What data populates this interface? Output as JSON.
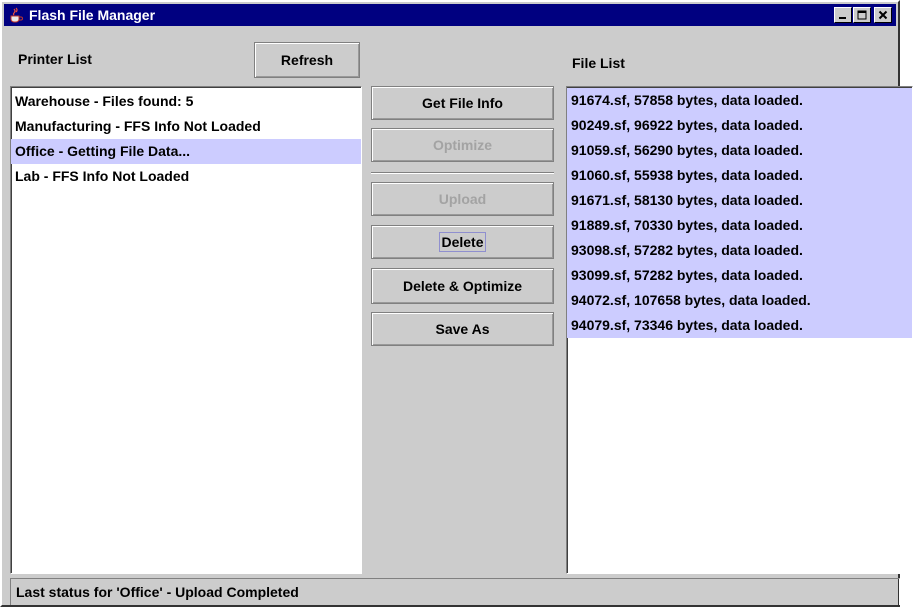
{
  "window": {
    "title": "Flash File Manager",
    "icon": "java-cup-icon",
    "controls": [
      "minimize-icon",
      "maximize-icon",
      "close-icon"
    ]
  },
  "printers": {
    "label": "Printer List",
    "refresh_label": "Refresh",
    "items": [
      {
        "text": "Warehouse - Files found: 5",
        "selected": false
      },
      {
        "text": "Manufacturing - FFS Info Not Loaded",
        "selected": false
      },
      {
        "text": "Office - Getting File Data...",
        "selected": true
      },
      {
        "text": "Lab - FFS Info Not Loaded",
        "selected": false
      }
    ]
  },
  "actions": {
    "get_file_info": "Get File Info",
    "optimize": "Optimize",
    "upload": "Upload",
    "delete": "Delete",
    "delete_optimize": "Delete & Optimize",
    "save_as": "Save As"
  },
  "files": {
    "label": "File List",
    "items": [
      "91674.sf, 57858 bytes, data loaded.",
      "90249.sf, 96922 bytes, data loaded.",
      "91059.sf, 56290 bytes, data loaded.",
      "91060.sf, 55938 bytes, data loaded.",
      "91671.sf, 58130 bytes, data loaded.",
      "91889.sf, 70330 bytes, data loaded.",
      "93098.sf, 57282 bytes, data loaded.",
      "93099.sf, 57282 bytes, data loaded.",
      "94072.sf, 107658 bytes, data loaded.",
      "94079.sf, 73346 bytes, data loaded."
    ]
  },
  "status": {
    "text": "Last status for 'Office' - Upload Completed"
  },
  "colors": {
    "titlebar": "#000080",
    "panel": "#cccccc",
    "selection": "#ccccff"
  }
}
